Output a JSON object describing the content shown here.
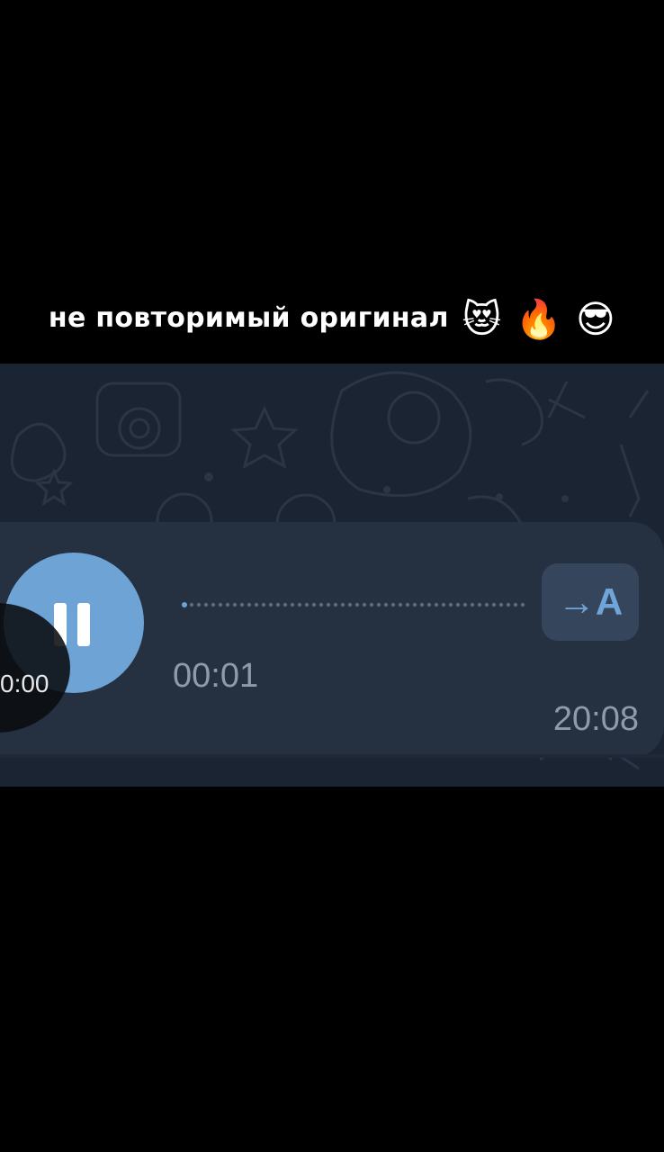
{
  "caption": {
    "text": "не повторимый оригинал",
    "emojis": "😻 🔥 😎"
  },
  "voice_message": {
    "duration": "00:01",
    "time": "20:08",
    "transcribe_label": "→A",
    "video_timer": "0:00",
    "progress": 0.03,
    "accent_color": "#6ea3d6"
  }
}
